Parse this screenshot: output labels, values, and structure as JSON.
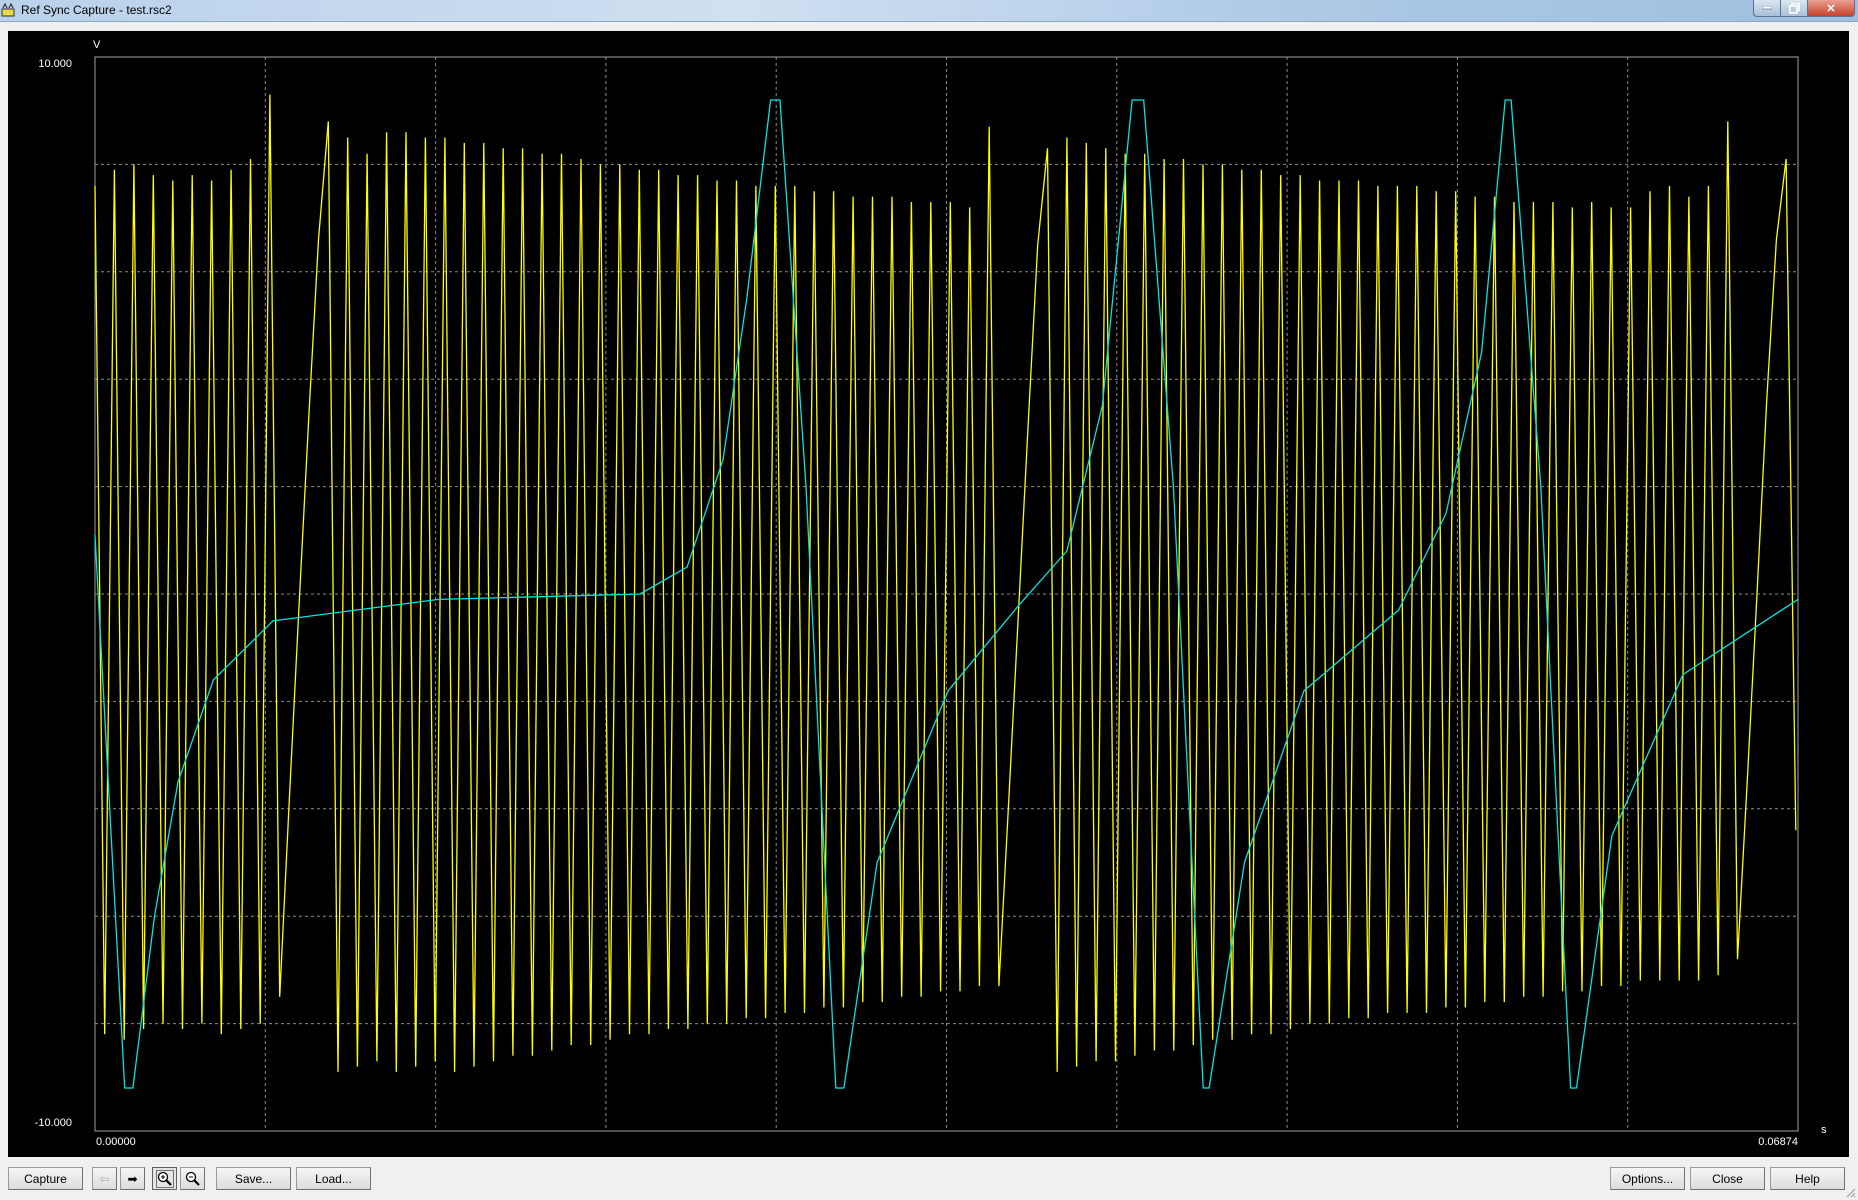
{
  "window": {
    "title": "Ref Sync Capture - test.rsc2"
  },
  "toolbar": {
    "capture_label": "Capture",
    "save_label": "Save...",
    "load_label": "Load...",
    "options_label": "Options...",
    "close_label": "Close",
    "help_label": "Help"
  },
  "chart_data": {
    "type": "line",
    "title": "",
    "ylabel": "V",
    "xlabel": "s",
    "ylim": [
      -10,
      10
    ],
    "xlim": [
      0,
      0.06874
    ],
    "y_tick_labels": [
      "10.000",
      "-10.000"
    ],
    "x_tick_labels": [
      "0.00000",
      "0.06874"
    ],
    "grid": true,
    "grid_divisions": {
      "x": 10,
      "y": 10
    },
    "colors": {
      "background": "#000000",
      "grid": "#8a8a8a",
      "frame": "#a0a0a0",
      "yellow_trace": "#ffff00",
      "cyan_trace": "#00e5e5"
    },
    "series": [
      {
        "color": "#ffff00",
        "sample_interval_s": 0.0003923,
        "values": [
          7.6,
          -8.2,
          7.9,
          -8.3,
          8.0,
          -8.1,
          7.8,
          -8.0,
          7.7,
          -8.1,
          7.8,
          -8.0,
          7.7,
          -8.2,
          7.9,
          -8.1,
          8.1,
          -8.0,
          9.3,
          -7.5,
          -3.8,
          -0.2,
          3.3,
          6.6,
          8.8,
          -8.9,
          8.5,
          -8.8,
          8.2,
          -8.7,
          8.6,
          -8.9,
          8.6,
          -8.8,
          8.5,
          -8.7,
          8.5,
          -8.9,
          8.4,
          -8.8,
          8.4,
          -8.7,
          8.3,
          -8.6,
          8.3,
          -8.6,
          8.2,
          -8.5,
          8.2,
          -8.4,
          8.1,
          -8.4,
          8.0,
          -8.3,
          8.0,
          -8.2,
          7.9,
          -8.2,
          7.9,
          -8.1,
          7.8,
          -8.1,
          7.8,
          -8.0,
          7.7,
          -8.0,
          7.7,
          -7.9,
          7.6,
          -7.9,
          7.6,
          -7.8,
          7.6,
          -7.8,
          7.5,
          -7.7,
          7.5,
          -7.7,
          7.4,
          -7.6,
          7.4,
          -7.6,
          7.4,
          -7.5,
          7.3,
          -7.5,
          7.3,
          -7.4,
          7.3,
          -7.4,
          7.2,
          -7.3,
          8.7,
          -7.3,
          -3.9,
          -0.4,
          3.1,
          6.5,
          8.3,
          -8.9,
          8.5,
          -8.8,
          8.4,
          -8.7,
          8.3,
          -8.7,
          8.2,
          -8.6,
          8.2,
          -8.5,
          8.1,
          -8.5,
          8.1,
          -8.4,
          8.0,
          -8.3,
          8.0,
          -8.3,
          7.9,
          -8.2,
          7.9,
          -8.2,
          7.8,
          -8.1,
          7.8,
          -8.0,
          7.7,
          -8.0,
          7.7,
          -7.9,
          7.7,
          -7.9,
          7.6,
          -7.8,
          7.6,
          -7.8,
          7.6,
          -7.8,
          7.5,
          -7.7,
          7.5,
          -7.7,
          7.4,
          -7.6,
          7.4,
          -7.6,
          7.3,
          -7.5,
          7.3,
          -7.5,
          7.3,
          -7.4,
          7.2,
          -7.4,
          7.3,
          -7.3,
          7.2,
          -7.3,
          7.2,
          -7.2,
          7.5,
          -7.2,
          7.6,
          -7.2,
          7.4,
          -7.2,
          7.6,
          -7.1,
          8.8,
          -6.8,
          -3.5,
          0.0,
          3.6,
          6.6,
          8.1,
          -4.4
        ]
      },
      {
        "color": "#00e5e5",
        "points": [
          [
            0,
            1.1
          ],
          [
            0.0012,
            -9.2
          ],
          [
            0.00153,
            -9.2
          ],
          [
            0.0024,
            -6
          ],
          [
            0.00335,
            -3.5
          ],
          [
            0.00478,
            -1.6
          ],
          [
            0.00718,
            -0.5
          ],
          [
            0.01387,
            -0.1
          ],
          [
            0.022,
            0
          ],
          [
            0.0239,
            0.5
          ],
          [
            0.02535,
            2.5
          ],
          [
            0.02631,
            5.5
          ],
          [
            0.02727,
            9.2
          ],
          [
            0.02765,
            9.2
          ],
          [
            0.0287,
            2
          ],
          [
            0.0299,
            -9.2
          ],
          [
            0.03023,
            -9.2
          ],
          [
            0.03157,
            -5
          ],
          [
            0.03444,
            -1.8
          ],
          [
            0.03731,
            -0.2
          ],
          [
            0.03923,
            0.8
          ],
          [
            0.04066,
            3.5
          ],
          [
            0.04186,
            9.2
          ],
          [
            0.04233,
            9.2
          ],
          [
            0.04353,
            2
          ],
          [
            0.04473,
            -9.2
          ],
          [
            0.04497,
            -9.2
          ],
          [
            0.0464,
            -5
          ],
          [
            0.0488,
            -1.8
          ],
          [
            0.05262,
            -0.3
          ],
          [
            0.05453,
            1.5
          ],
          [
            0.05597,
            4.5
          ],
          [
            0.05692,
            9.2
          ],
          [
            0.05716,
            9.2
          ],
          [
            0.05836,
            2
          ],
          [
            0.05956,
            -9.2
          ],
          [
            0.0598,
            -9.2
          ],
          [
            0.06123,
            -4.5
          ],
          [
            0.0641,
            -1.5
          ],
          [
            0.06874,
            -0.1
          ]
        ]
      }
    ]
  }
}
